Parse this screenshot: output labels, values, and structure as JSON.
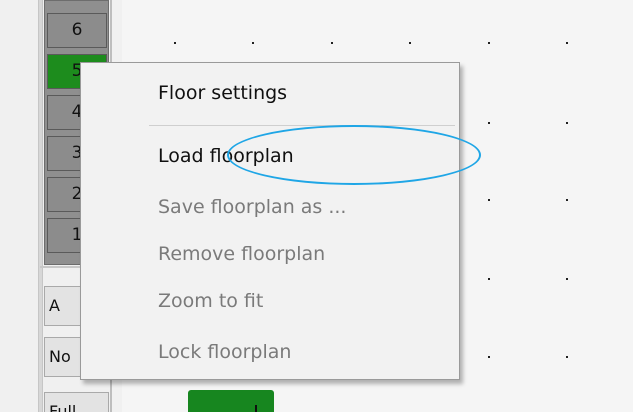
{
  "floors": [
    {
      "label": "6",
      "active": false
    },
    {
      "label": "5",
      "active": true
    },
    {
      "label": "4",
      "active": false
    },
    {
      "label": "3",
      "active": false
    },
    {
      "label": "2",
      "active": false
    },
    {
      "label": "1",
      "active": false
    }
  ],
  "side_buttons": [
    {
      "label": "A"
    },
    {
      "label": "No"
    },
    {
      "label": "Full"
    }
  ],
  "context_menu": {
    "items": [
      {
        "label": "Floor settings",
        "enabled": true
      },
      {
        "label": "Load floorplan",
        "enabled": true
      },
      {
        "label": "Save floorplan as ...",
        "enabled": false
      },
      {
        "label": "Remove floorplan",
        "enabled": false
      },
      {
        "label": "Zoom to fit",
        "enabled": false
      },
      {
        "label": "Lock floorplan",
        "enabled": false
      }
    ]
  },
  "colors": {
    "active_floor": "#1d8c1d",
    "highlight": "#1fa6e6",
    "disabled_text": "#7a7a7a"
  }
}
